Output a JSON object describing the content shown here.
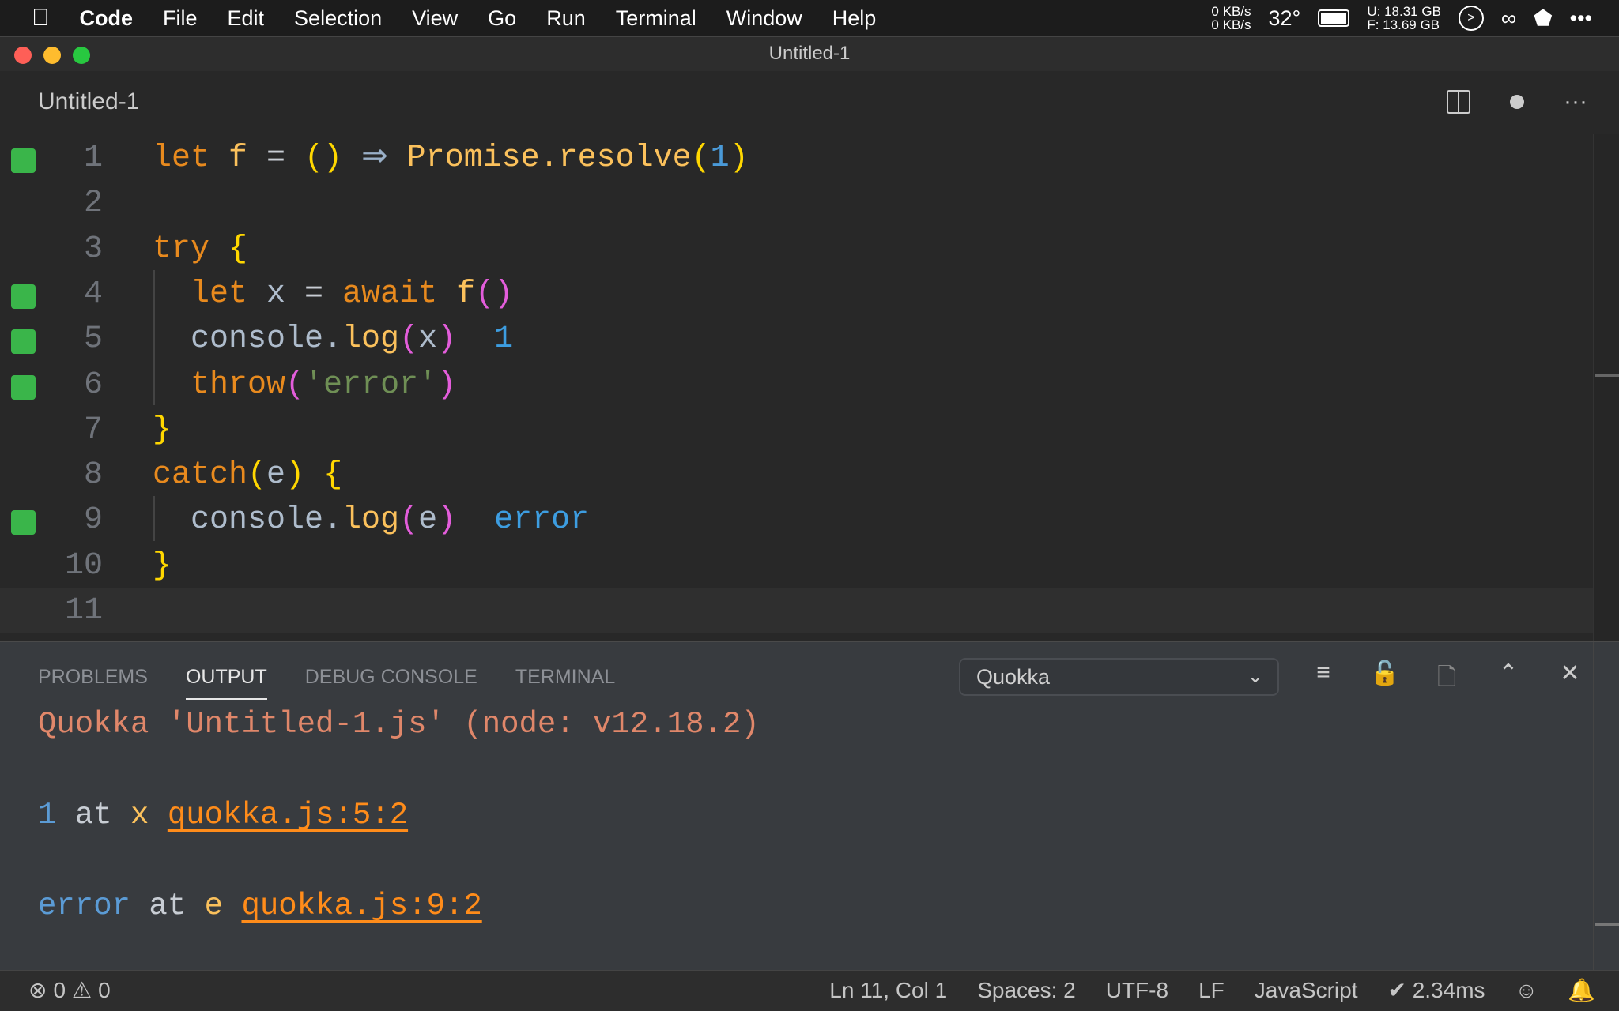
{
  "menubar": {
    "apple": "",
    "app": "Code",
    "items": [
      "File",
      "Edit",
      "Selection",
      "View",
      "Go",
      "Run",
      "Terminal",
      "Window",
      "Help"
    ],
    "net_up": "0 KB/s",
    "net_down": "0 KB/s",
    "temp": "32°",
    "disk_used": "U:  18.31 GB",
    "disk_free": "F:  13.69 GB",
    "more": "•••"
  },
  "window": {
    "title": "Untitled-1"
  },
  "tab": {
    "title": "Untitled-1"
  },
  "editor": {
    "lines": [
      {
        "n": "1",
        "cov": true,
        "t": [
          [
            "let ",
            "#e88a1e"
          ],
          [
            "f ",
            "#fbc15c"
          ],
          [
            "= ",
            "#c8cdd4"
          ],
          [
            "() ",
            "#ffd700"
          ],
          [
            "⇒ ",
            "#9ab0c8"
          ],
          [
            "Promise.resolve",
            "#fbc15c"
          ],
          [
            "(",
            "#ffd700"
          ],
          [
            "1",
            "#4a9ad8"
          ],
          [
            ")",
            "#ffd700"
          ]
        ]
      },
      {
        "n": "2",
        "cov": false,
        "t": []
      },
      {
        "n": "3",
        "cov": false,
        "t": [
          [
            "try ",
            "#e88a1e"
          ],
          [
            "{",
            "#ffd700"
          ]
        ]
      },
      {
        "n": "4",
        "cov": true,
        "t": [
          [
            "  let ",
            "#e88a1e"
          ],
          [
            "x ",
            "#aebccc"
          ],
          [
            "= ",
            "#c8cdd4"
          ],
          [
            "await ",
            "#e88a1e"
          ],
          [
            "f",
            "#fbc15c"
          ],
          [
            "()",
            "#e35ddb"
          ]
        ]
      },
      {
        "n": "5",
        "cov": true,
        "t": [
          [
            "  console.",
            "#aebccc"
          ],
          [
            "log",
            "#fbc15c"
          ],
          [
            "(",
            "#e35ddb"
          ],
          [
            "x",
            "#aebccc"
          ],
          [
            ")",
            "#e35ddb"
          ],
          [
            "  1",
            "#3d9de0"
          ]
        ]
      },
      {
        "n": "6",
        "cov": true,
        "t": [
          [
            "  throw",
            "#e88a1e"
          ],
          [
            "(",
            "#e35ddb"
          ],
          [
            "'error'",
            "#6f8f55"
          ],
          [
            ")",
            "#e35ddb"
          ]
        ]
      },
      {
        "n": "7",
        "cov": false,
        "t": [
          [
            "}",
            "#ffd700"
          ]
        ]
      },
      {
        "n": "8",
        "cov": false,
        "t": [
          [
            "catch",
            "#e88a1e"
          ],
          [
            "(",
            "#ffd700"
          ],
          [
            "e",
            "#aebccc"
          ],
          [
            ") ",
            "#ffd700"
          ],
          [
            "{",
            "#ffd700"
          ]
        ]
      },
      {
        "n": "9",
        "cov": true,
        "t": [
          [
            "  console.",
            "#aebccc"
          ],
          [
            "log",
            "#fbc15c"
          ],
          [
            "(",
            "#e35ddb"
          ],
          [
            "e",
            "#aebccc"
          ],
          [
            ")",
            "#e35ddb"
          ],
          [
            "  error",
            "#3d9de0"
          ]
        ]
      },
      {
        "n": "10",
        "cov": false,
        "t": [
          [
            "}",
            "#ffd700"
          ]
        ]
      },
      {
        "n": "11",
        "cov": false,
        "t": []
      }
    ]
  },
  "panel": {
    "tabs": [
      "PROBLEMS",
      "OUTPUT",
      "DEBUG CONSOLE",
      "TERMINAL"
    ],
    "active_tab": "OUTPUT",
    "channel": "Quokka",
    "output": {
      "header": "Quokka 'Untitled-1.js' (node: v12.18.2)",
      "l1": {
        "value": "1",
        "at": " at ",
        "name": "x ",
        "link": "quokka.js:5:2"
      },
      "l2": {
        "value": "error",
        "at": " at ",
        "name": "e ",
        "link": "quokka.js:9:2"
      }
    }
  },
  "status": {
    "errors": "0",
    "warnings": "0",
    "position": "Ln 11, Col 1",
    "spaces": "Spaces: 2",
    "encoding": "UTF-8",
    "eol": "LF",
    "language": "JavaScript",
    "quokka": "✔ 2.34ms"
  },
  "colors": {
    "coverage": "#3ab54a",
    "link": "#ff8c1a",
    "header": "#e0876a"
  }
}
